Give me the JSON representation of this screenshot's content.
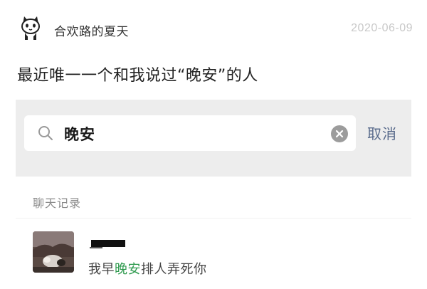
{
  "post": {
    "username": "合欢路的夏天",
    "date": "2020-06-09",
    "text": "最近唯一一个和我说过“晚安”的人"
  },
  "search": {
    "value": "晚安",
    "cancel_label": "取消"
  },
  "results": {
    "section_label": "聊天记录",
    "message": {
      "before": "我早",
      "highlight": "晚安",
      "after": "排人弄死你"
    }
  },
  "colors": {
    "highlight": "#2e9a4e",
    "cancel": "#586a8b",
    "date": "#c8c8c8"
  },
  "icons": {
    "user_avatar": "cat-cartoon-icon",
    "search": "search-icon",
    "clear": "clear-icon"
  }
}
